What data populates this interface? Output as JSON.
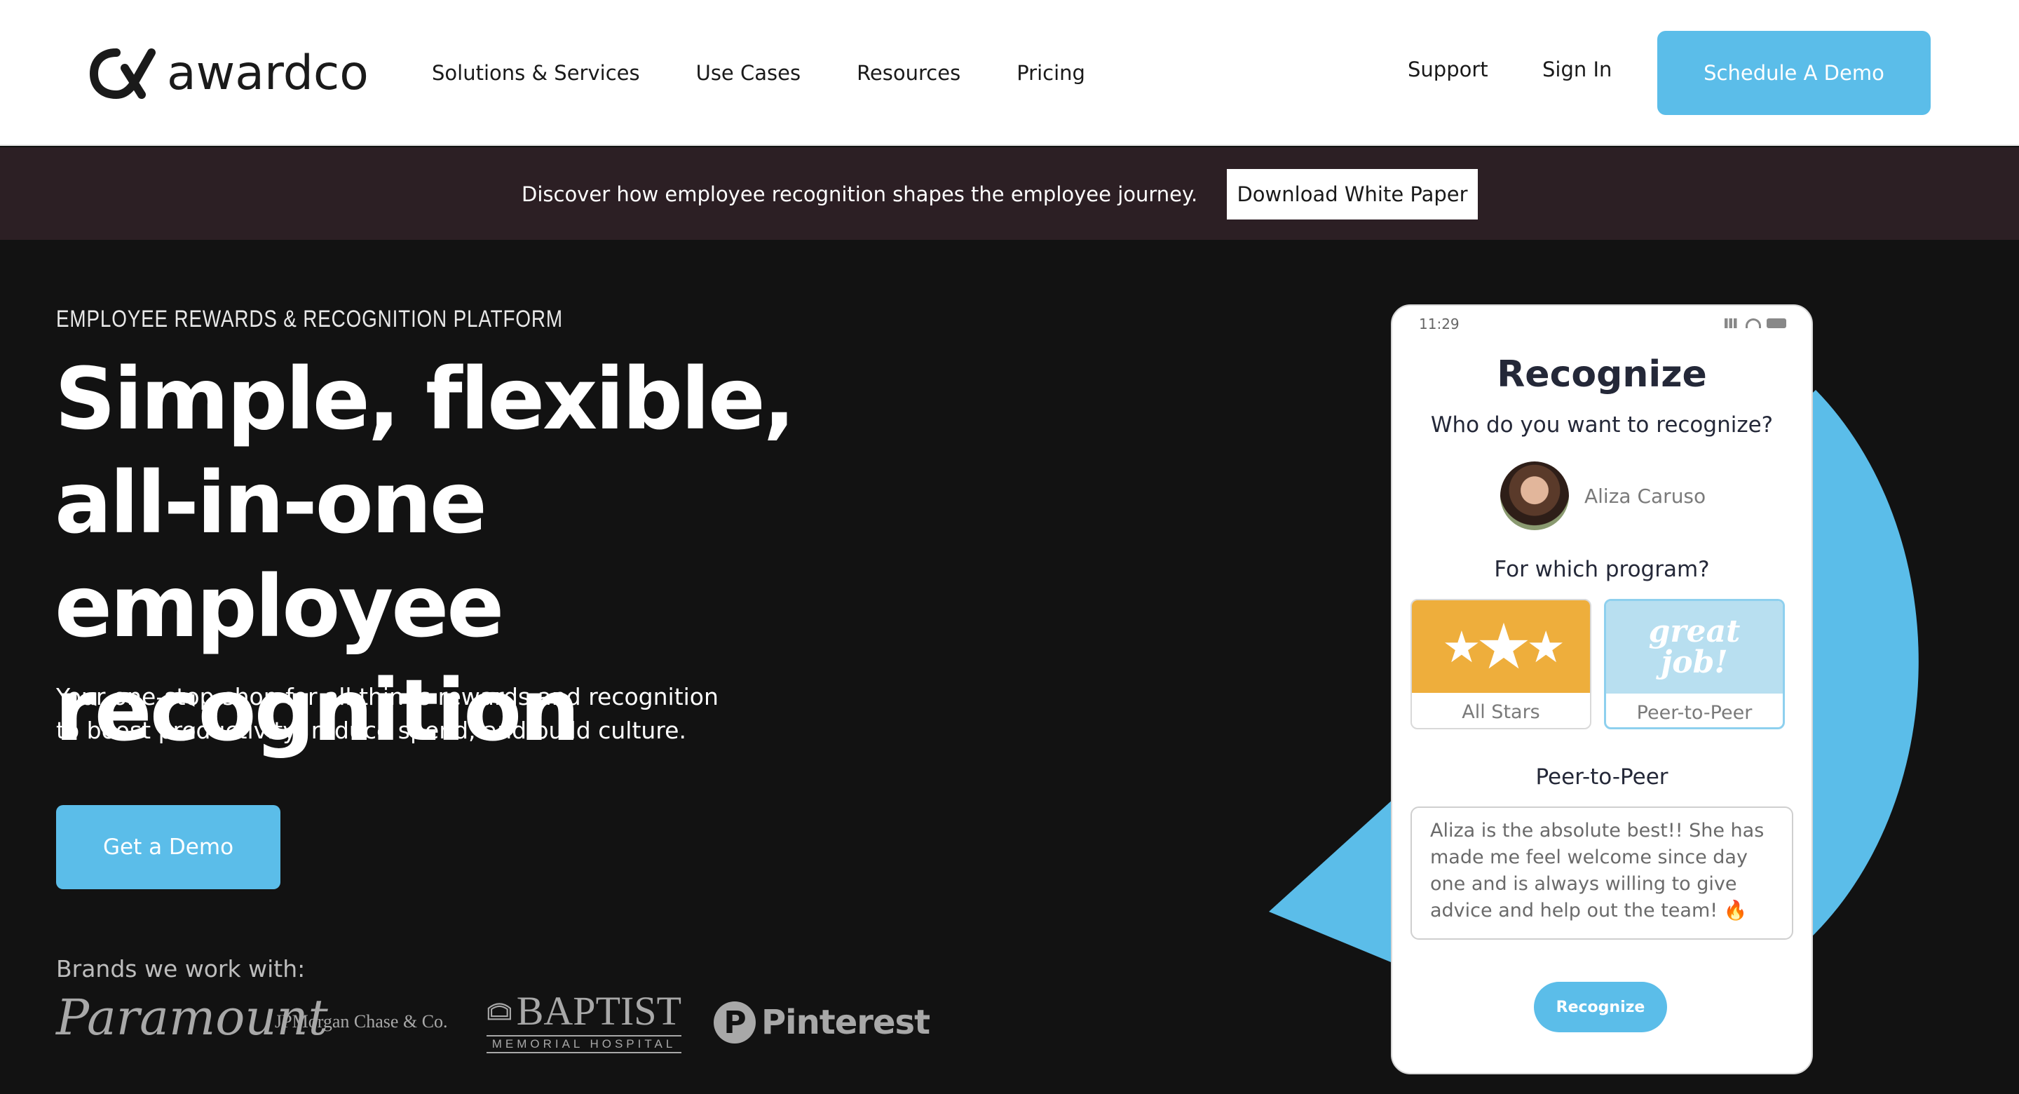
{
  "header": {
    "logo_text": "awardco",
    "nav": [
      "Solutions & Services",
      "Use Cases",
      "Resources",
      "Pricing"
    ],
    "support_label": "Support",
    "signin_label": "Sign In",
    "cta_label": "Schedule A Demo"
  },
  "banner": {
    "text": "Discover how employee recognition shapes the employee journey.",
    "button_label": "Download White Paper"
  },
  "hero": {
    "eyebrow": "EMPLOYEE REWARDS & RECOGNITION PLATFORM",
    "headline": "Simple, flexible, all-in-one employee recognition",
    "subtext": "Your one-stop-shop for all things rewards and recognition to boost productivity, reduce spend, and build culture.",
    "cta_label": "Get a Demo",
    "brands_label": "Brands we work with:",
    "brands": {
      "paramount": "Paramount",
      "jpmorgan": "JPMorgan Chase & Co.",
      "baptist_main": "BAPTIST",
      "baptist_sub": "MEMORIAL HOSPITAL",
      "pinterest": "Pinterest"
    }
  },
  "phone": {
    "time": "11:29",
    "title": "Recognize",
    "question_who": "Who do you want to recognize?",
    "person_name": "Aliza Caruso",
    "question_program": "For which program?",
    "programs": [
      {
        "label": "All Stars",
        "art": "★★★"
      },
      {
        "label": "Peer-to-Peer",
        "art": "great job!"
      }
    ],
    "selected_program": "Peer-to-Peer",
    "message": "Aliza is the absolute best!! She has made me feel welcome since day one and is always willing to give advice and help out the team! 🔥",
    "button_label": "Recognize"
  },
  "colors": {
    "accent": "#5bbde9",
    "banner_bg": "#2c1f24",
    "page_bg": "#121212",
    "all_stars_bg": "#eeae3c"
  }
}
